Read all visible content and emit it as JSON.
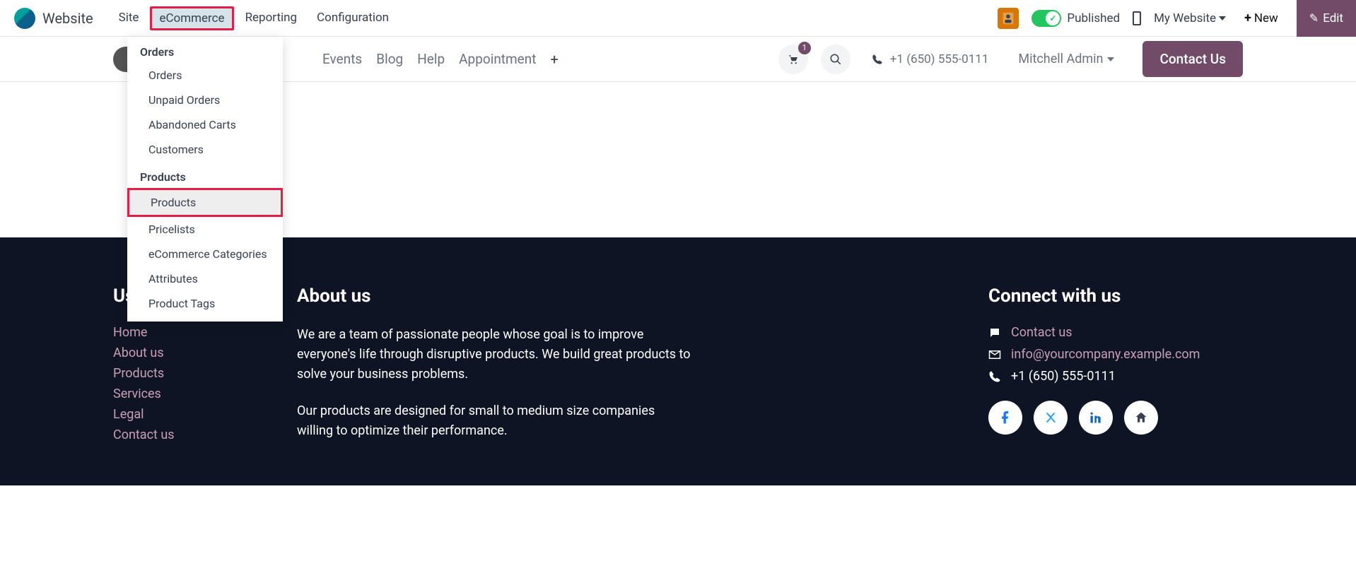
{
  "admin": {
    "app_name": "Website",
    "menu": {
      "site": "Site",
      "ecommerce": "eCommerce",
      "reporting": "Reporting",
      "configuration": "Configuration"
    },
    "published": "Published",
    "my_website": "My Website",
    "new": "New",
    "edit": "Edit"
  },
  "dropdown": {
    "orders_header": "Orders",
    "orders": "Orders",
    "unpaid_orders": "Unpaid Orders",
    "abandoned_carts": "Abandoned Carts",
    "customers": "Customers",
    "products_header": "Products",
    "products": "Products",
    "pricelists": "Pricelists",
    "ecom_categories": "eCommerce Categories",
    "attributes": "Attributes",
    "product_tags": "Product Tags"
  },
  "nav": {
    "events": "Events",
    "blog": "Blog",
    "help": "Help",
    "appointment": "Appointment",
    "cart_count": "1",
    "phone": "+1 (650) 555-0111",
    "user": "Mitchell Admin",
    "contact_us": "Contact Us"
  },
  "footer": {
    "useful_links_title": "Useful Links",
    "links": {
      "home": "Home",
      "about_us": "About us",
      "products": "Products",
      "services": "Services",
      "legal": "Legal",
      "contact_us": "Contact us"
    },
    "about_title": "About us",
    "about_p1": "We are a team of passionate people whose goal is to improve everyone's life through disruptive products. We build great products to solve your business problems.",
    "about_p2": "Our products are designed for small to medium size companies willing to optimize their performance.",
    "connect_title": "Connect with us",
    "contact_link": "Contact us",
    "email": "info@yourcompany.example.com",
    "phone": "+1 (650) 555-0111"
  }
}
